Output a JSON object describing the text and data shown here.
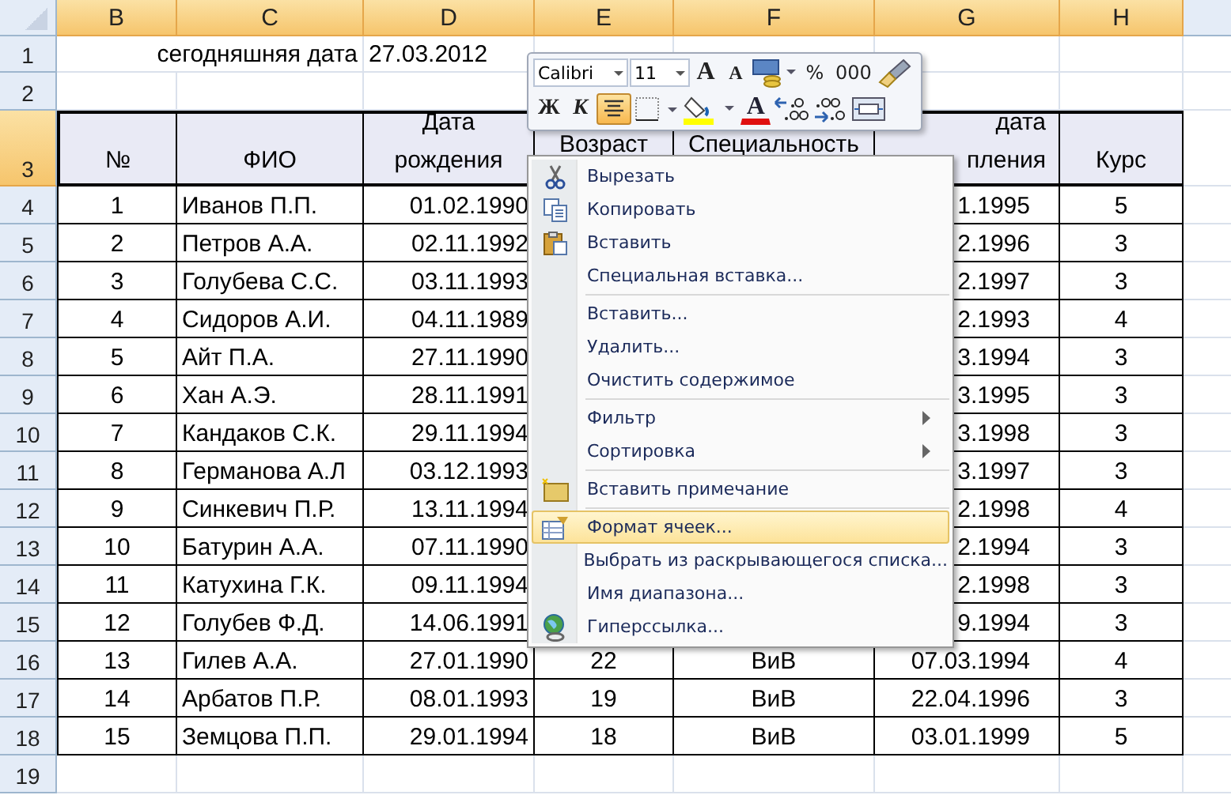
{
  "columns": [
    {
      "label": "B",
      "selected": true
    },
    {
      "label": "C",
      "selected": true
    },
    {
      "label": "D",
      "selected": true
    },
    {
      "label": "E",
      "selected": true
    },
    {
      "label": "F",
      "selected": true
    },
    {
      "label": "G",
      "selected": true
    },
    {
      "label": "H",
      "selected": true
    }
  ],
  "rows": [
    {
      "row": "1",
      "selected": false,
      "kind": "plain",
      "cells": {
        "c": "сегодняшняя дата",
        "d": "27.03.2012"
      }
    },
    {
      "row": "2",
      "selected": false,
      "kind": "blank"
    },
    {
      "row": "3",
      "selected": true,
      "kind": "header",
      "cells": {
        "b": "№",
        "c": "ФИО",
        "d": "Дата рождения",
        "e": "Возраст",
        "f": "Специальность",
        "g": "дата\nпления",
        "h": "Курс"
      }
    },
    {
      "row": "4",
      "selected": false,
      "kind": "data",
      "cells": {
        "b": "1",
        "c": "Иванов П.П.",
        "d": "01.02.1990",
        "g": "1.1995",
        "h": "5"
      }
    },
    {
      "row": "5",
      "selected": false,
      "kind": "data",
      "cells": {
        "b": "2",
        "c": "Петров А.А.",
        "d": "02.11.1992",
        "g": "2.1996",
        "h": "3"
      }
    },
    {
      "row": "6",
      "selected": false,
      "kind": "data",
      "cells": {
        "b": "3",
        "c": "Голубева С.С.",
        "d": "03.11.1993",
        "g": "2.1997",
        "h": "3"
      }
    },
    {
      "row": "7",
      "selected": false,
      "kind": "data",
      "cells": {
        "b": "4",
        "c": "Сидоров А.И.",
        "d": "04.11.1989",
        "g": "2.1993",
        "h": "4"
      }
    },
    {
      "row": "8",
      "selected": false,
      "kind": "data",
      "cells": {
        "b": "5",
        "c": "Айт П.А.",
        "d": "27.11.1990",
        "g": "3.1994",
        "h": "3"
      }
    },
    {
      "row": "9",
      "selected": false,
      "kind": "data",
      "cells": {
        "b": "6",
        "c": "Хан А.Э.",
        "d": "28.11.1991",
        "g": "3.1995",
        "h": "3"
      }
    },
    {
      "row": "10",
      "selected": false,
      "kind": "data",
      "cells": {
        "b": "7",
        "c": "Кандаков С.К.",
        "d": "29.11.1994",
        "g": "3.1998",
        "h": "3"
      }
    },
    {
      "row": "11",
      "selected": false,
      "kind": "data",
      "cells": {
        "b": "8",
        "c": "Германова А.Л",
        "d": "03.12.1993",
        "g": "3.1997",
        "h": "3"
      }
    },
    {
      "row": "12",
      "selected": false,
      "kind": "data",
      "cells": {
        "b": "9",
        "c": "Синкевич П.Р.",
        "d": "13.11.1994",
        "g": "2.1998",
        "h": "4"
      }
    },
    {
      "row": "13",
      "selected": false,
      "kind": "data",
      "cells": {
        "b": "10",
        "c": "Батурин А.А.",
        "d": "07.11.1990",
        "g": "2.1994",
        "h": "3"
      }
    },
    {
      "row": "14",
      "selected": false,
      "kind": "data",
      "cells": {
        "b": "11",
        "c": "Катухина Г.К.",
        "d": "09.11.1994",
        "g": "2.1998",
        "h": "3"
      }
    },
    {
      "row": "15",
      "selected": false,
      "kind": "data",
      "cells": {
        "b": "12",
        "c": "Голубев Ф.Д.",
        "d": "14.06.1991",
        "g": "9.1994",
        "h": "3"
      }
    },
    {
      "row": "16",
      "selected": false,
      "kind": "data",
      "cells": {
        "b": "13",
        "c": "Гилев А.А.",
        "d": "27.01.1990",
        "e": "22",
        "f": "ВиВ",
        "g": "07.03.1994",
        "h": "4"
      }
    },
    {
      "row": "17",
      "selected": false,
      "kind": "data",
      "cells": {
        "b": "14",
        "c": "Арбатов П.Р.",
        "d": "08.01.1993",
        "e": "19",
        "f": "ВиВ",
        "g": "22.04.1996",
        "h": "3"
      }
    },
    {
      "row": "18",
      "selected": false,
      "kind": "data",
      "cells": {
        "b": "15",
        "c": "Земцова П.П.",
        "d": "29.01.1994",
        "e": "18",
        "f": "ВиВ",
        "g": "03.01.1999",
        "h": "5"
      }
    },
    {
      "row": "19",
      "selected": false,
      "kind": "blank"
    }
  ],
  "mini_toolbar": {
    "font": "Calibri",
    "size": "11",
    "grow": "A",
    "shrink": "A",
    "percent": "%",
    "thousands": "000",
    "bold": "Ж",
    "italic": "К",
    "align_center": {
      "selected": true
    },
    "font_color": "A"
  },
  "context_menu": [
    {
      "kind": "item",
      "label": "Вырезать",
      "selected": false
    },
    {
      "kind": "item",
      "label": "Копировать",
      "selected": false
    },
    {
      "kind": "item",
      "label": "Вставить",
      "selected": false
    },
    {
      "kind": "item",
      "label": "Специальная вставка...",
      "selected": false
    },
    {
      "kind": "separator"
    },
    {
      "kind": "item",
      "label": "Вставить...",
      "selected": false
    },
    {
      "kind": "item",
      "label": "Удалить...",
      "selected": false
    },
    {
      "kind": "item",
      "label": "Очистить содержимое",
      "selected": false
    },
    {
      "kind": "separator"
    },
    {
      "kind": "submenu",
      "label": "Фильтр",
      "selected": false
    },
    {
      "kind": "submenu",
      "label": "Сортировка",
      "selected": false
    },
    {
      "kind": "separator"
    },
    {
      "kind": "item",
      "label": "Вставить примечание",
      "selected": false
    },
    {
      "kind": "separator"
    },
    {
      "kind": "item",
      "label": "Формат ячеек...",
      "selected": true
    },
    {
      "kind": "item",
      "label": "Выбрать из раскрывающегося списка...",
      "selected": false
    },
    {
      "kind": "item",
      "label": "Имя диапазона...",
      "selected": false
    },
    {
      "kind": "item",
      "label": "Гиперссылка...",
      "selected": false
    }
  ]
}
